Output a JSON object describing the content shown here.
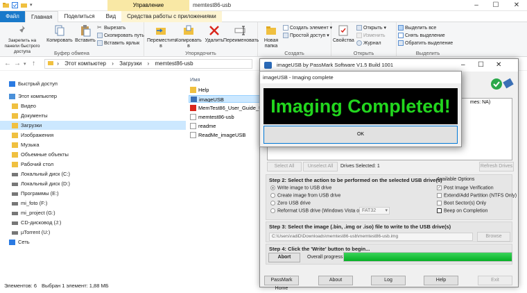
{
  "explorer": {
    "window_title": "memtest86-usb",
    "context_tab": "Управление",
    "tabs": {
      "file": "Файл",
      "home": "Главная",
      "share": "Поделиться",
      "view": "Вид",
      "tools": "Средства работы с приложениями"
    },
    "ribbon": {
      "clipboard": {
        "pin": "Закрепить на панели быстрого доступа",
        "copy": "Копировать",
        "paste": "Вставить",
        "cut": "Вырезать",
        "copy_path": "Скопировать путь",
        "paste_shortcut": "Вставить ярлык",
        "label": "Буфер обмена"
      },
      "organize": {
        "move": "Переместить в",
        "copyto": "Копировать в",
        "delete": "Удалить",
        "rename": "Переименовать",
        "label": "Упорядочить"
      },
      "create": {
        "new_folder": "Новая папка",
        "new_item": "Создать элемент",
        "easy_access": "Простой доступ",
        "label": "Создать"
      },
      "open": {
        "properties": "Свойства",
        "open": "Открыть",
        "edit": "Изменить",
        "history": "Журнал",
        "label": "Открыть"
      },
      "select": {
        "select_all": "Выделить все",
        "select_none": "Снять выделение",
        "invert": "Обратить выделение",
        "label": "Выделить"
      }
    },
    "address": [
      "Этот компьютер",
      "Загрузки",
      "memtest86-usb"
    ],
    "nav": [
      {
        "label": "Быстрый доступ",
        "top": true
      },
      {
        "label": "Этот компьютер",
        "top": true
      },
      {
        "label": "Видео"
      },
      {
        "label": "Документы"
      },
      {
        "label": "Загрузки",
        "selected": true
      },
      {
        "label": "Изображения"
      },
      {
        "label": "Музыка"
      },
      {
        "label": "Объемные объекты"
      },
      {
        "label": "Рабочий стол"
      },
      {
        "label": "Локальный диск (C:)"
      },
      {
        "label": "Локальный диск (D:)"
      },
      {
        "label": "Программы  (E:)"
      },
      {
        "label": "mi_foto (F:)"
      },
      {
        "label": "mi_project (G:)"
      },
      {
        "label": "CD-дисковод (J:)"
      },
      {
        "label": "µTorrent (U:)"
      },
      {
        "label": "Сеть",
        "top": true
      }
    ],
    "column_name": "Имя",
    "files": [
      {
        "name": "Help",
        "type": "folder"
      },
      {
        "name": "imageUSB",
        "type": "app",
        "selected": true
      },
      {
        "name": "MemTest86_User_Guide_UEFI",
        "type": "pdf"
      },
      {
        "name": "memtest86-usb",
        "type": "file"
      },
      {
        "name": "readme",
        "type": "file"
      },
      {
        "name": "ReadMe_imageUSB",
        "type": "file"
      }
    ],
    "status": {
      "count": "Элементов: 6",
      "selected": "Выбран 1 элемент: 1,88 МБ"
    }
  },
  "imageusb": {
    "title": "imageUSB by PassMark Software V1.5 Build 1001",
    "list_hint": "mes: NA)",
    "select_all": "Select All",
    "unselect_all": "Unselect All",
    "drives_selected": "Drives Selected: 1",
    "refresh": "Refresh Drives",
    "step2": "Step 2: Select the action to be performed on the selected USB drive(s)",
    "actions": [
      "Write image to USB drive",
      "Create image from USB drive",
      "Zero USB drive",
      "Reformat USB drive (Windows Vista or later)"
    ],
    "fs_value": "FAT32",
    "options_title": "Available Options",
    "options": [
      "Post Image Verification",
      "Extend/Add Partition (NTFS Only)",
      "Boot Sector(s) Only",
      "Beep on Completion"
    ],
    "step3": "Step 3: Select the image (.bin, .img or .iso) file to write to the USB drive(s)",
    "image_path": "C:\\Users\\radiD\\Downloads\\memtest86-usb\\memtest86-usb.img",
    "browse": "Browse",
    "step4": "Step 4: Click the 'Write' button to begin...",
    "abort": "Abort",
    "overall": "Overall progress",
    "progress": 1.0,
    "bottom": {
      "home": "PassMark Home",
      "about": "About",
      "log": "Log",
      "help": "Help",
      "exit": "Exit"
    }
  },
  "dialog": {
    "title": "imageUSB - Imaging complete",
    "message": "Imaging Completed!",
    "ok": "OK"
  }
}
